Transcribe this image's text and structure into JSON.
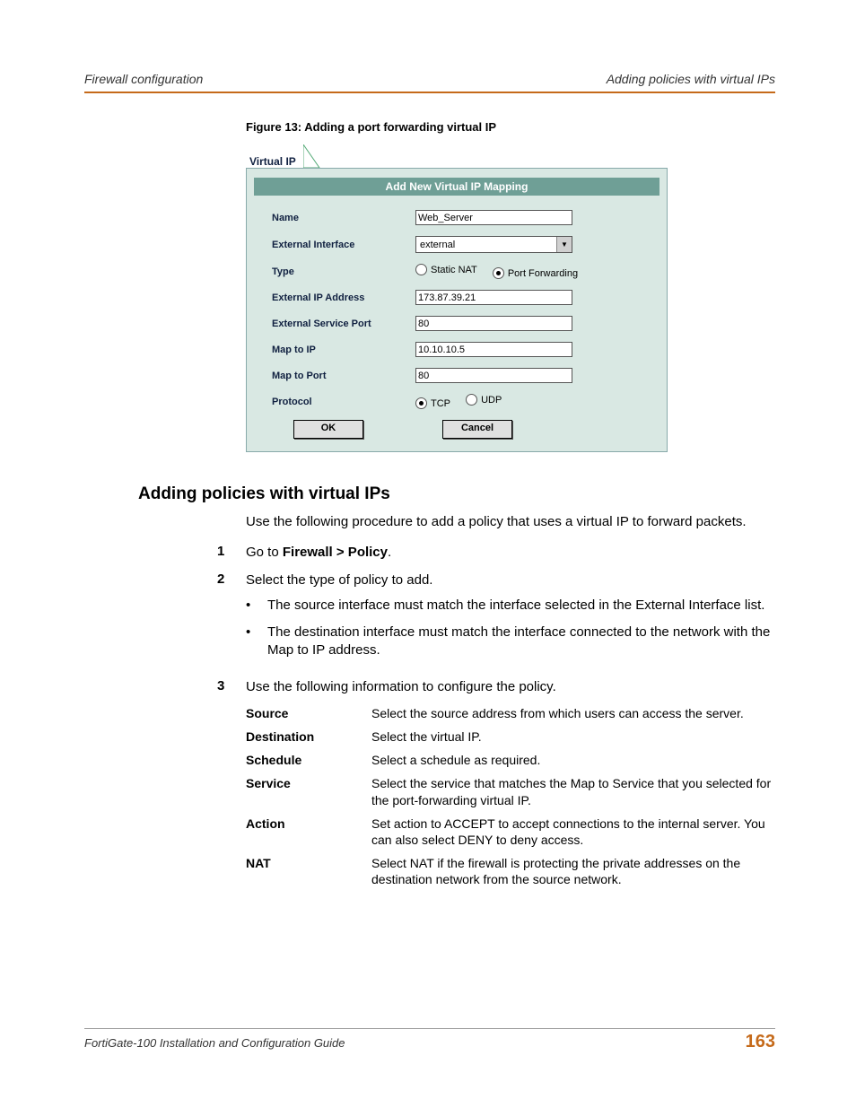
{
  "header": {
    "left": "Firewall configuration",
    "right": "Adding policies with virtual IPs"
  },
  "figure_caption": "Figure 13: Adding a port forwarding virtual IP",
  "dialog": {
    "tab": "Virtual IP",
    "title": "Add New Virtual IP Mapping",
    "nameLabel": "Name",
    "nameValue": "Web_Server",
    "extIfaceLabel": "External Interface",
    "extIfaceValue": "external",
    "typeLabel": "Type",
    "typeStatic": "Static NAT",
    "typePortFwd": "Port Forwarding",
    "extIpLabel": "External IP Address",
    "extIpValue": "173.87.39.21",
    "extPortLabel": "External Service Port",
    "extPortValue": "80",
    "mapIpLabel": "Map to IP",
    "mapIpValue": "10.10.10.5",
    "mapPortLabel": "Map to Port",
    "mapPortValue": "80",
    "protoLabel": "Protocol",
    "protoTcp": "TCP",
    "protoUdp": "UDP",
    "ok": "OK",
    "cancel": "Cancel"
  },
  "section": {
    "title": "Adding policies with virtual IPs",
    "intro": "Use the following procedure to add a policy that uses a virtual IP to forward packets.",
    "step1_pre": "Go to ",
    "step1_bold": "Firewall > Policy",
    "step1_post": ".",
    "step2": "Select the type of policy to add.",
    "bullet1": "The source interface must match the interface selected in the External Interface list.",
    "bullet2": "The destination interface must match the interface connected to the network with the Map to IP address.",
    "step3": "Use the following information to configure the policy."
  },
  "config": {
    "sourceK": "Source",
    "sourceV": "Select the source address from which users can access the server.",
    "destK": "Destination",
    "destV": "Select the virtual IP.",
    "schedK": "Schedule",
    "schedV": "Select a schedule as required.",
    "servK": "Service",
    "servV": "Select the service that matches the Map to Service that you selected for the port-forwarding virtual IP.",
    "actK": "Action",
    "actV": "Set action to ACCEPT to accept connections to the internal server. You can also select DENY to deny access.",
    "natK": "NAT",
    "natV": "Select NAT if the firewall is protecting the private addresses on the destination network from the source network."
  },
  "footer": {
    "left": "FortiGate-100 Installation and Configuration Guide",
    "page": "163"
  }
}
